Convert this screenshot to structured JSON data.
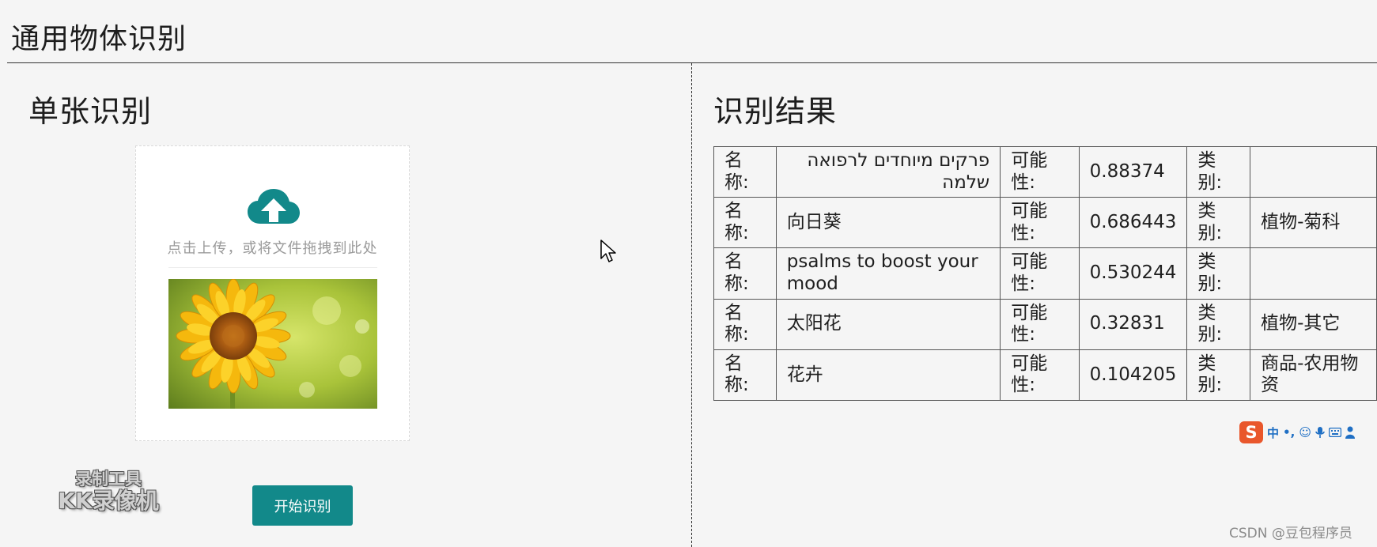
{
  "app": {
    "title": "通用物体识别"
  },
  "left_panel": {
    "title": "单张识别",
    "upload": {
      "hint": "点击上传，或将文件拖拽到此处",
      "icon": "cloud-upload-icon",
      "accent": "#12898a"
    },
    "start_button": "开始识别"
  },
  "right_panel": {
    "title": "识别结果",
    "labels": {
      "name": "名称:",
      "probability": "可能性:",
      "category": "类别:"
    },
    "results": [
      {
        "name": "פרקים מיוחדים לרפואה שלמה",
        "probability": "0.88374",
        "category": ""
      },
      {
        "name": "向日葵",
        "probability": "0.686443",
        "category": "植物-菊科"
      },
      {
        "name": "psalms to boost your mood",
        "probability": "0.530244",
        "category": ""
      },
      {
        "name": "太阳花",
        "probability": "0.32831",
        "category": "植物-其它"
      },
      {
        "name": "花卉",
        "probability": "0.104205",
        "category": "商品-农用物资"
      }
    ]
  },
  "overlays": {
    "watermark": {
      "line1": "录制工具",
      "line2": "KK录像机"
    },
    "ime_toolbar": {
      "logo": "S",
      "items": [
        "中",
        "•,",
        "☺",
        "mic-icon",
        "keyboard-icon",
        "user-icon"
      ]
    },
    "csdn": "CSDN @豆包程序员"
  }
}
